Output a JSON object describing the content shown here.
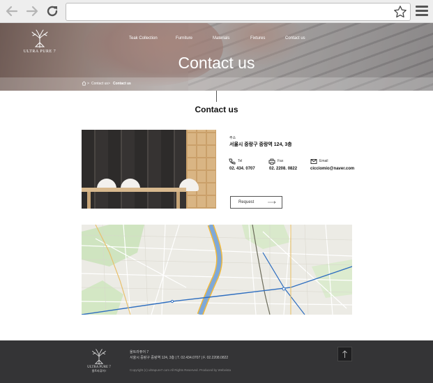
{
  "browser": {
    "url_value": ""
  },
  "site": {
    "logo_text": "ULTRA PURE 7",
    "nav": [
      "Teak Collection",
      "Furniture",
      "Materials",
      "Fixtures",
      "Contact us"
    ],
    "hero_title": "Contact us",
    "breadcrumb": [
      "Contact us",
      "Contact us"
    ]
  },
  "content": {
    "title": "Contact us",
    "address_label": "주소",
    "address": "서울시 중랑구 중랑역 124, 3층",
    "tel_label": "Tel",
    "tel": "02. 434. 0707",
    "fax_label": "Fax",
    "fax": "02. 2208. 0822",
    "email_label": "Email",
    "email": "cicciomio@naver.com",
    "request_label": "Request"
  },
  "footer": {
    "logo_text": "ULTRA PURE 7",
    "logo_sub": "울트라퓨어7",
    "company": "울트라퓨어 7",
    "info": "서울시 중랑구 중랑역 124, 3층    |    T. 02.434.0707    |    F. 02.2208.0822",
    "copyright": "Copyright (c) ultrapure7.com   All Rights Reserved.    Produced by Webvista"
  },
  "colors": {
    "footer_bg": "#343436",
    "accent": "#1f1f21"
  }
}
